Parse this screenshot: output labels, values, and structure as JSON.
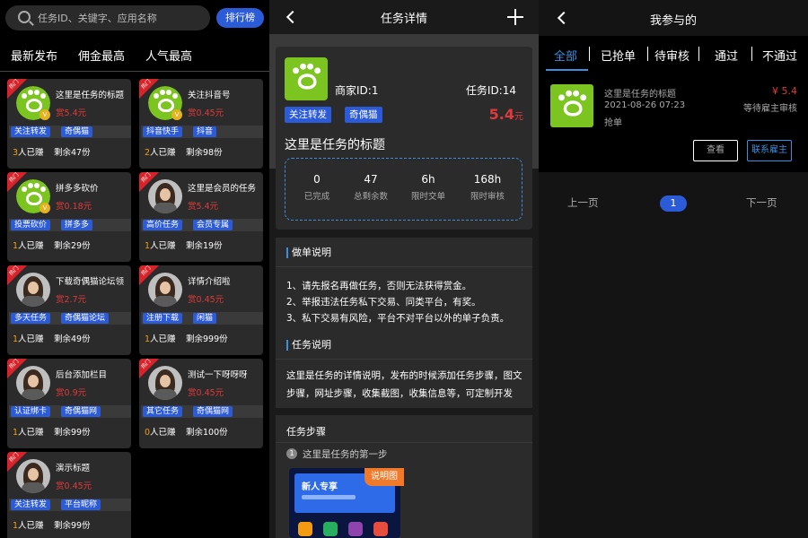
{
  "list": {
    "search_placeholder": "任务ID、关键字、应用名称",
    "rank_button": "排行榜",
    "tabs": [
      "最新发布",
      "佣金最高",
      "人气最高"
    ],
    "hot_label": "热门",
    "earned_suffix": "人已赚",
    "cards": [
      {
        "title": "这里是任务的标题",
        "reward": "赏5.4元",
        "tags": [
          "关注转发",
          "奇偶猫"
        ],
        "earned": "3",
        "remain": "剩余47份",
        "thumb": "paw",
        "verified": true
      },
      {
        "title": "关注抖音号",
        "reward": "赏0.45元",
        "tags": [
          "抖音快手",
          "抖音"
        ],
        "earned": "2",
        "remain": "剩余98份",
        "thumb": "paw",
        "verified": true
      },
      {
        "title": "拼多多砍价",
        "reward": "赏0.18元",
        "tags": [
          "投票砍价",
          "拼多多"
        ],
        "earned": "1",
        "remain": "剩余29份",
        "thumb": "paw",
        "verified": true
      },
      {
        "title": "这里是会员的任务",
        "reward": "赏5.4元",
        "tags": [
          "高价任务",
          "会员专属"
        ],
        "earned": "1",
        "remain": "剩余19份",
        "thumb": "girl",
        "verified": false
      },
      {
        "title": "下载奇偶猫论坛领",
        "reward": "赏2.7元",
        "tags": [
          "多天任务",
          "奇偶猫论坛"
        ],
        "earned": "1",
        "remain": "剩余49份",
        "thumb": "girl",
        "verified": false
      },
      {
        "title": "详情介绍啦",
        "reward": "赏0.45元",
        "tags": [
          "注册下载",
          "闲猫"
        ],
        "earned": "1",
        "remain": "剩余999份",
        "thumb": "girl",
        "verified": false
      },
      {
        "title": "后台添加栏目",
        "reward": "赏0.9元",
        "tags": [
          "认证绑卡",
          "奇偶猫网"
        ],
        "earned": "1",
        "remain": "剩余99份",
        "thumb": "girl",
        "verified": false
      },
      {
        "title": "测试一下呀呀呀",
        "reward": "赏0.45元",
        "tags": [
          "其它任务",
          "奇偶猫网"
        ],
        "earned": "0",
        "remain": "剩余100份",
        "thumb": "girl",
        "verified": false
      },
      {
        "title": "演示标题",
        "reward": "赏0.45元",
        "tags": [
          "关注转发",
          "平台昵称"
        ],
        "earned": "1",
        "remain": "剩余99份",
        "thumb": "girl",
        "verified": false
      }
    ]
  },
  "detail": {
    "nav_title": "任务详情",
    "merchant": "商家ID:1",
    "task_id": "任务ID:14",
    "tags": [
      "关注转发",
      "奇偶猫"
    ],
    "price": "5.4",
    "price_unit": "元",
    "title": "这里是任务的标题",
    "stats": [
      {
        "value": "0",
        "label": "已完成"
      },
      {
        "value": "47",
        "label": "总剩余数"
      },
      {
        "value": "6h",
        "label": "限时交单"
      },
      {
        "value": "168h",
        "label": "限时审核"
      }
    ],
    "rules_heading": "做单说明",
    "rules": [
      "1、请先报名再做任务，否则无法获得赏金。",
      "2、举报违法任务私下交易、同类平台，有奖。",
      "3、私下交易有风险，平台不对平台以外的单子负责。"
    ],
    "desc_heading": "任务说明",
    "description": "这里是任务的详情说明，发布的时候添加任务步骤，图文步骤，网址步骤，收集截图，收集信息等，可定制开发",
    "steps_heading": "任务步骤",
    "step_num": "1",
    "step_text": "这里是任务的第一步",
    "step_badge": "说明图",
    "banner_text": "新人专享"
  },
  "joined": {
    "nav_title": "我参与的",
    "tabs": [
      "全部",
      "已抢单",
      "待审核",
      "通过",
      "不通过"
    ],
    "order": {
      "title": "这里是任务的标题",
      "price": "¥ 5.4",
      "time": "2021-08-26 07:23",
      "status_text": "等待雇主审核",
      "state": "抢单",
      "view_button": "查看",
      "contact_button": "联系雇主"
    },
    "prev": "上一页",
    "page": "1",
    "next": "下一页"
  },
  "colors": {
    "accent": "#2c5bd8",
    "price": "#e03a3a",
    "dash": "#3c8ee0"
  }
}
